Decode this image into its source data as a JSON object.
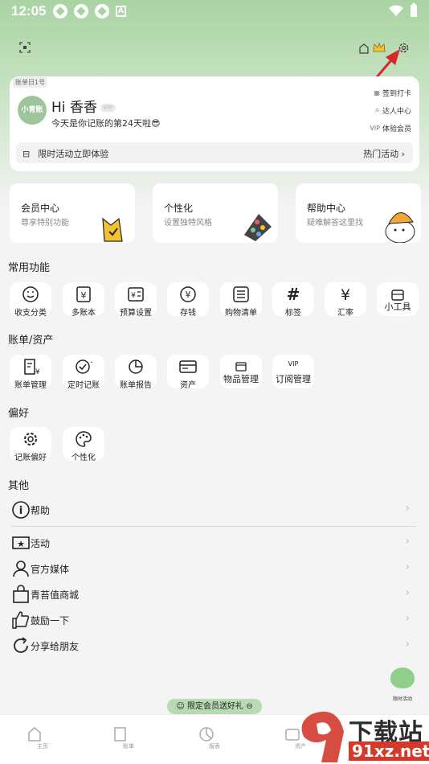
{
  "statusbar": {
    "time": "12:05",
    "badge": "A"
  },
  "header": {
    "bill_date_tag": "账单日1号"
  },
  "profile": {
    "avatar_text": "小青账",
    "greeting": "Hi 香香",
    "vip_pill": "VIP",
    "days_text": "今天是你记账的第24天啦😎",
    "quick_links": [
      {
        "label": "签到打卡",
        "icon": "calendar-icon"
      },
      {
        "label": "达人中心",
        "icon": "sun-icon"
      },
      {
        "label": "体验会员",
        "icon": "vip-icon",
        "prefix": "VIP"
      }
    ],
    "promo_left": "限时活动立即体验",
    "promo_right": "热门活动 ›"
  },
  "feature_cards": [
    {
      "title": "会员中心",
      "sub": "尊享特别功能"
    },
    {
      "title": "个性化",
      "sub": "设置独特风格"
    },
    {
      "title": "帮助中心",
      "sub": "疑难解答这里找"
    }
  ],
  "sections": {
    "common": "常用功能",
    "bills": "账单/资产",
    "prefs": "偏好",
    "others": "其他"
  },
  "common_items": [
    {
      "label": "收支分类",
      "icon": "☺"
    },
    {
      "label": "多账本",
      "icon": "¥"
    },
    {
      "label": "预算设置",
      "icon": "¥"
    },
    {
      "label": "存钱",
      "icon": "¥"
    },
    {
      "label": "购物清单",
      "icon": "☰"
    },
    {
      "label": "标签",
      "icon": "#"
    },
    {
      "label": "汇率",
      "icon": "¥"
    },
    {
      "label": "小工具",
      "icon": "▣"
    }
  ],
  "bill_items": [
    {
      "label": "账单管理",
      "icon": "≡"
    },
    {
      "label": "定时记账",
      "icon": "✓"
    },
    {
      "label": "账单报告",
      "icon": "◔"
    },
    {
      "label": "资产",
      "icon": "▭"
    },
    {
      "label": "物品管理",
      "icon": "▢"
    },
    {
      "label": "订阅管理",
      "icon": "VIP"
    }
  ],
  "pref_items": [
    {
      "label": "记账偏好",
      "icon": "⚙"
    },
    {
      "label": "个性化",
      "icon": "◐"
    }
  ],
  "other_items": [
    {
      "label": "帮助",
      "icon": "i"
    },
    {
      "label": "活动",
      "icon": "★"
    },
    {
      "label": "官方媒体",
      "icon": "person"
    },
    {
      "label": "青苔值商城",
      "icon": "bag"
    },
    {
      "label": "鼓励一下",
      "icon": "thumb"
    },
    {
      "label": "分享给朋友",
      "icon": "share"
    }
  ],
  "floating": {
    "banner": "限定会员送好礼",
    "frog_label": "限时活动"
  },
  "tabs": [
    {
      "label": "主页"
    },
    {
      "label": "账单"
    },
    {
      "label": "报表"
    },
    {
      "label": "资产"
    }
  ],
  "watermark": {
    "brand": "下载站",
    "url": "91xz.net"
  },
  "colors": {
    "accent": "#a9d3a3",
    "arrow": "#d32b2b"
  }
}
